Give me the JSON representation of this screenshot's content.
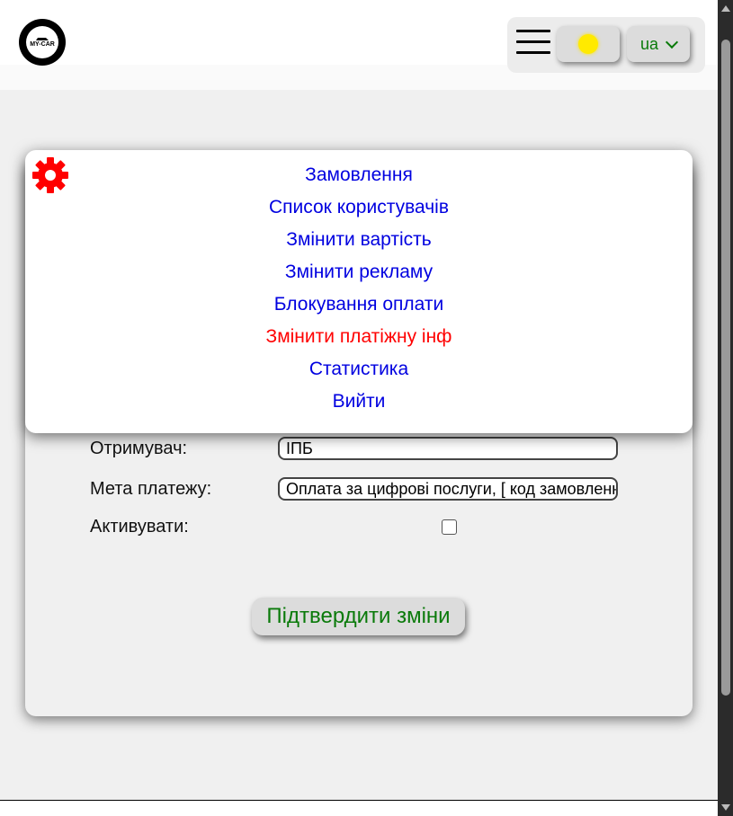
{
  "header": {
    "logo_text": "MY-CAR",
    "language": "ua"
  },
  "menu": {
    "items": [
      {
        "label": "Замовлення"
      },
      {
        "label": "Список користувачів"
      },
      {
        "label": "Змінити вартість"
      },
      {
        "label": "Змінити рекламу"
      },
      {
        "label": "Блокування оплати"
      },
      {
        "label": "Змінити платіжну інф"
      },
      {
        "label": "Статистика"
      },
      {
        "label": "Вийти"
      }
    ],
    "active_color": "#ff0000",
    "link_color": "#0000e0"
  },
  "form": {
    "recipient_label": "Отримувач:",
    "recipient_value": "ІПБ",
    "purpose_label": "Мета платежу:",
    "purpose_value": "Оплата за цифрові послуги, [ код замовлення ]",
    "activate_label": "Активувати:",
    "activate_checked": false,
    "confirm_label": "Підтвердити зміни"
  }
}
